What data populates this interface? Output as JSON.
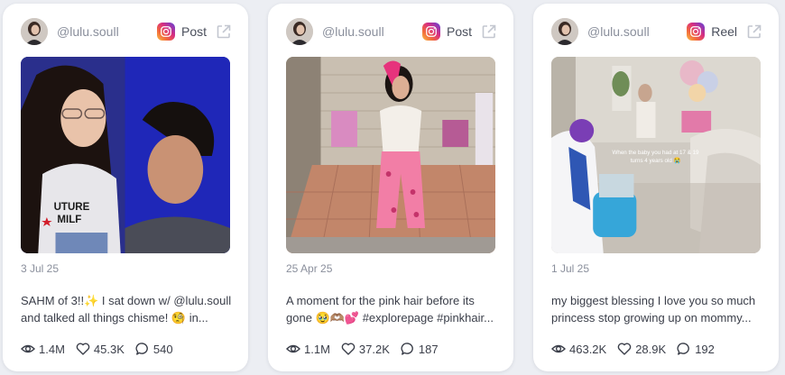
{
  "posts": [
    {
      "handle": "@lulu.soull",
      "type_label": "Post",
      "type_icon": "instagram-icon",
      "date": "3 Jul 25",
      "caption_line1": "SAHM of 3!!✨ I sat down w/ @lulu.soull",
      "caption_line2": "and talked all things chisme! 🧐 in...",
      "views": "1.4M",
      "likes": "45.3K",
      "comments": "540"
    },
    {
      "handle": "@lulu.soull",
      "type_label": "Post",
      "type_icon": "instagram-icon",
      "date": "25 Apr 25",
      "caption_line1": "A moment for the pink hair before its",
      "caption_line2": "gone 🥹🫶🏽💕 #explorepage #pinkhair...",
      "views": "1.1M",
      "likes": "37.2K",
      "comments": "187"
    },
    {
      "handle": "@lulu.soull",
      "type_label": "Reel",
      "type_icon": "instagram-icon",
      "date": "1 Jul 25",
      "caption_line1": "my biggest blessing I love you so much",
      "caption_line2": "princess stop growing up on mommy...",
      "overlay_text_line1": "When the baby you had at 17 & 19",
      "overlay_text_line2": "turns 4 years old 😭",
      "views": "463.2K",
      "likes": "28.9K",
      "comments": "192"
    }
  ],
  "colors": {
    "background": "#eceef3",
    "card": "#ffffff",
    "muted_text": "#8a8f9c",
    "body_text": "#3a3e49"
  }
}
